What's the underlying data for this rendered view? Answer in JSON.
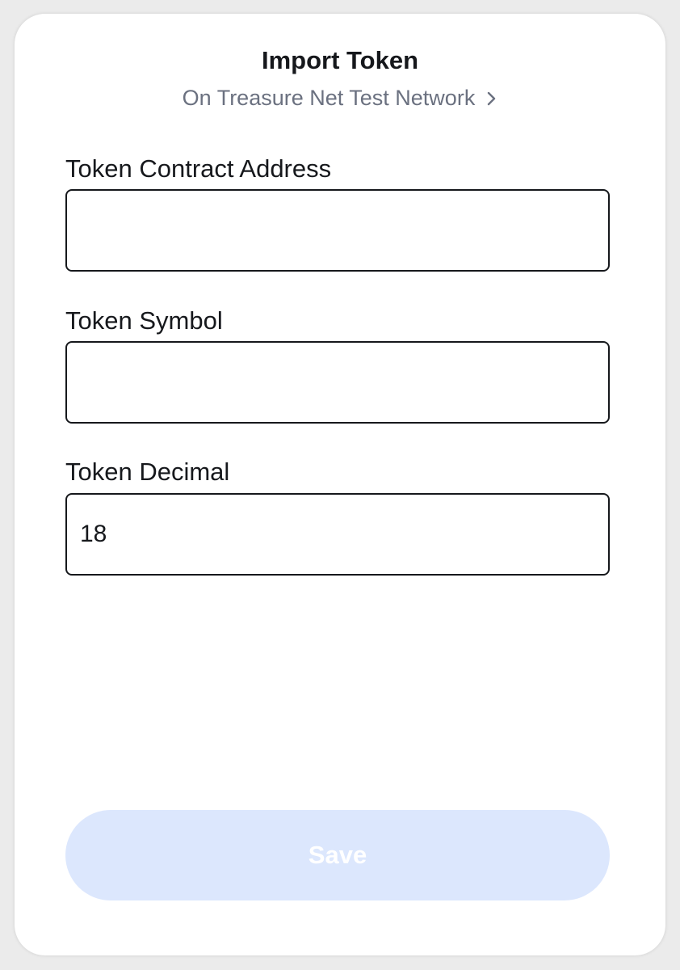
{
  "header": {
    "title": "Import Token",
    "network_label": "On Treasure Net Test Network",
    "network_chevron_icon": "chevron-right-icon"
  },
  "form": {
    "contract_address": {
      "label": "Token Contract Address",
      "value": ""
    },
    "symbol": {
      "label": "Token Symbol",
      "value": ""
    },
    "decimal": {
      "label": "Token Decimal",
      "value": "18"
    }
  },
  "actions": {
    "save_label": "Save",
    "save_enabled": false
  },
  "colors": {
    "save_button_disabled_bg": "#dce7fd",
    "subtitle_text": "#6b7180",
    "primary_text": "#16181c"
  }
}
